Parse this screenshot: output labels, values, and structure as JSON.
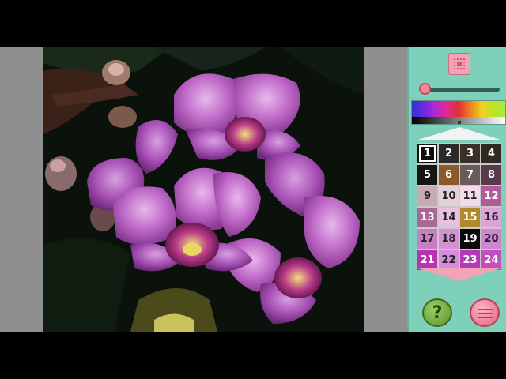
{
  "canvas": {
    "subject": "orchid-painting",
    "background_color": "#0c120c"
  },
  "panel": {
    "background_color": "#7fd0bb",
    "fit_icon": "fit-to-screen-icon",
    "help_label": "?",
    "menu_icon": "hamburger-menu-icon",
    "zoom_level": 0.05,
    "selected_color": "1"
  },
  "palette": [
    {
      "label": "1",
      "bg": "#0d0d0d",
      "fg": "#ffffff"
    },
    {
      "label": "2",
      "bg": "#2a2a2a",
      "fg": "#ffffff"
    },
    {
      "label": "3",
      "bg": "#3a302a",
      "fg": "#ffffff"
    },
    {
      "label": "4",
      "bg": "#2f2a20",
      "fg": "#ffffff"
    },
    {
      "label": "5",
      "bg": "#151515",
      "fg": "#ffffff"
    },
    {
      "label": "6",
      "bg": "#8a5a2a",
      "fg": "#ffffff"
    },
    {
      "label": "7",
      "bg": "#6a5a5a",
      "fg": "#ffffff"
    },
    {
      "label": "8",
      "bg": "#5a3a4a",
      "fg": "#ffffff"
    },
    {
      "label": "9",
      "bg": "#c7aab5",
      "fg": "#222222"
    },
    {
      "label": "10",
      "bg": "#e5d0d8",
      "fg": "#222222"
    },
    {
      "label": "11",
      "bg": "#f3dce8",
      "fg": "#222222"
    },
    {
      "label": "12",
      "bg": "#b25a9a",
      "fg": "#ffffff"
    },
    {
      "label": "13",
      "bg": "#a86a95",
      "fg": "#ffffff"
    },
    {
      "label": "14",
      "bg": "#eac0e0",
      "fg": "#222222"
    },
    {
      "label": "15",
      "bg": "#b08a2a",
      "fg": "#ffffff"
    },
    {
      "label": "16",
      "bg": "#dca3d8",
      "fg": "#222222"
    },
    {
      "label": "17",
      "bg": "#c57fc2",
      "fg": "#222222"
    },
    {
      "label": "18",
      "bg": "#d690d6",
      "fg": "#222222"
    },
    {
      "label": "19",
      "bg": "#0a0a0a",
      "fg": "#ffffff"
    },
    {
      "label": "20",
      "bg": "#cf86d0",
      "fg": "#222222"
    },
    {
      "label": "21",
      "bg": "#b733b0",
      "fg": "#ffffff"
    },
    {
      "label": "22",
      "bg": "#d88bd8",
      "fg": "#222222"
    },
    {
      "label": "23",
      "bg": "#b43ab5",
      "fg": "#ffffff"
    },
    {
      "label": "24",
      "bg": "#c24ec2",
      "fg": "#ffffff"
    }
  ]
}
